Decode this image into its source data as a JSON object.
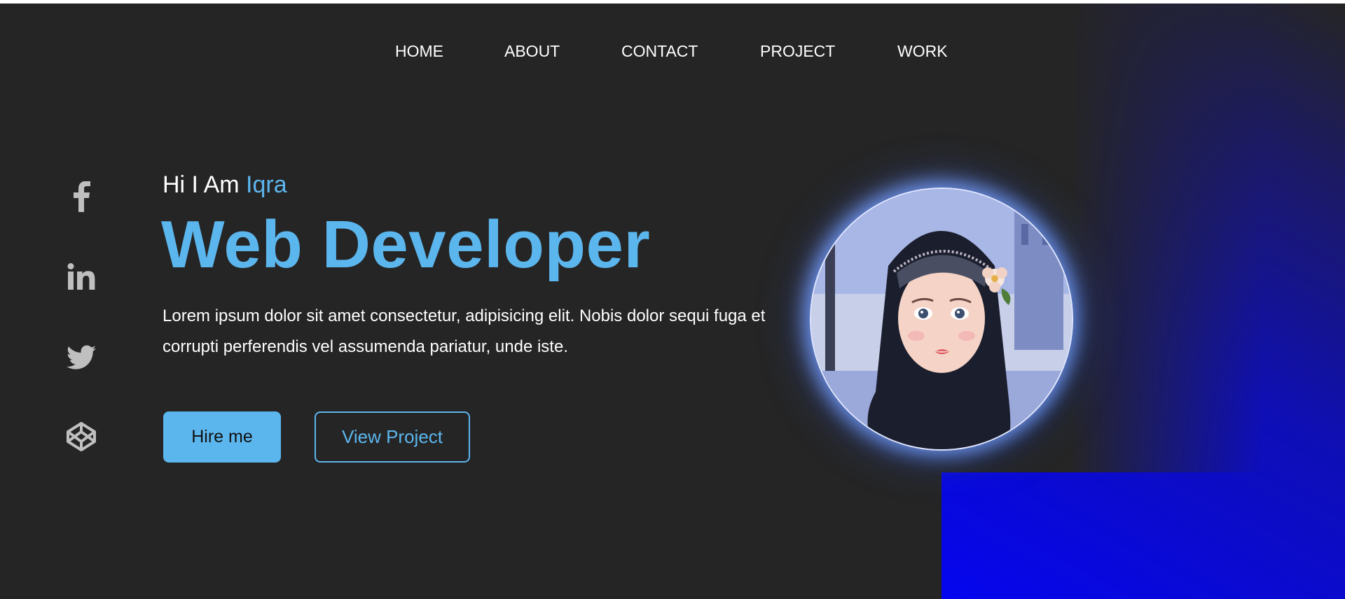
{
  "nav": {
    "items": [
      "HOME",
      "ABOUT",
      "CONTACT",
      "PROJECT",
      "WORK"
    ]
  },
  "social": [
    "facebook-icon",
    "linkedin-icon",
    "twitter-icon",
    "codepen-icon"
  ],
  "hero": {
    "greeting": "Hi I Am ",
    "name": "Iqra",
    "title": "Web Developer",
    "description": "Lorem ipsum dolor sit amet consectetur, adipisicing elit. Nobis dolor sequi fuga et corrupti perferendis vel assumenda pariatur, unde iste.",
    "hire_label": "Hire me",
    "view_label": "View Project"
  },
  "colors": {
    "background": "#252525",
    "accent": "#5cb6ee",
    "gradient_end": "#0505ef",
    "social_icon": "#bfbfbf"
  }
}
